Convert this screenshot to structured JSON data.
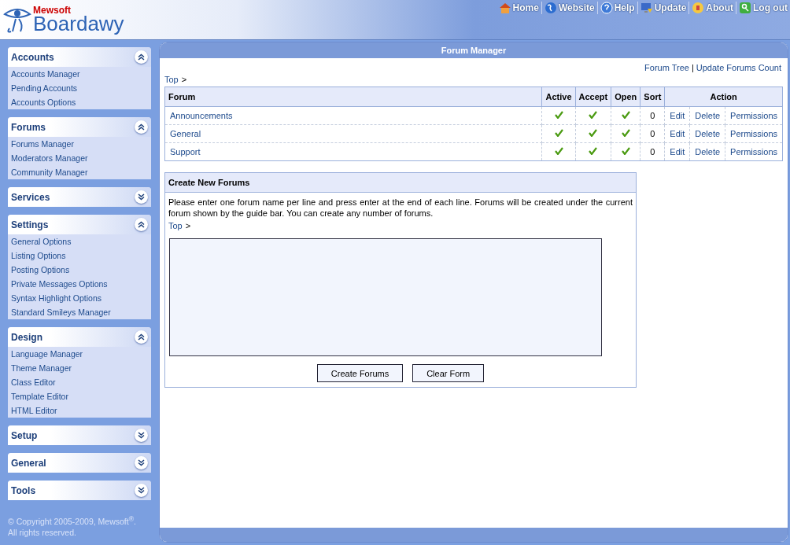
{
  "brand": {
    "maker": "Mewsoft",
    "product": "Boardawy"
  },
  "top_nav": [
    {
      "label": "Home"
    },
    {
      "label": "Website"
    },
    {
      "label": "Help"
    },
    {
      "label": "Update"
    },
    {
      "label": "About"
    },
    {
      "label": "Log out"
    }
  ],
  "sidebar": {
    "sections": [
      {
        "title": "Accounts",
        "expanded": true,
        "items": [
          "Accounts Manager",
          "Pending Accounts",
          "Accounts Options"
        ]
      },
      {
        "title": "Forums",
        "expanded": true,
        "items": [
          "Forums Manager",
          "Moderators Manager",
          "Community Manager"
        ]
      },
      {
        "title": "Services",
        "expanded": false
      },
      {
        "title": "Settings",
        "expanded": true,
        "items": [
          "General Options",
          "Listing Options",
          "Posting Options",
          "Private Messages Options",
          "Syntax Highlight Options",
          "Standard Smileys Manager"
        ]
      },
      {
        "title": "Design",
        "expanded": true,
        "items": [
          "Language Manager",
          "Theme Manager",
          "Class Editor",
          "Template Editor",
          "HTML Editor"
        ]
      },
      {
        "title": "Setup",
        "expanded": false
      },
      {
        "title": "General",
        "expanded": false
      },
      {
        "title": "Tools",
        "expanded": false
      }
    ],
    "copyright": "© Copyright 2005-2009, Mewsoft$^{®}$.",
    "rights": "All rights reserved."
  },
  "panel": {
    "title": "Forum Manager",
    "links": [
      "Forum Tree",
      "Update Forums Count"
    ],
    "link_separator": "|",
    "breadcrumb": {
      "link": "Top",
      "sep": ">"
    },
    "table": {
      "columns": [
        "Forum",
        "Active",
        "Accept",
        "Open",
        "Sort",
        "Action"
      ],
      "rows": [
        {
          "forum": "Announcements",
          "active": true,
          "accept": true,
          "open": true,
          "sort": "0",
          "actions": [
            "Edit",
            "Delete",
            "Permissions"
          ]
        },
        {
          "forum": "General",
          "active": true,
          "accept": true,
          "open": true,
          "sort": "0",
          "actions": [
            "Edit",
            "Delete",
            "Permissions"
          ]
        },
        {
          "forum": "Support",
          "active": true,
          "accept": true,
          "open": true,
          "sort": "0",
          "actions": [
            "Edit",
            "Delete",
            "Permissions"
          ]
        }
      ]
    },
    "create": {
      "title": "Create New Forums",
      "help": "Please enter one forum name per line and press enter at the end of each line. Forums will be created under the current forum shown by the guide bar. You can create any number of forums.",
      "breadcrumb": {
        "link": "Top",
        "sep": ">"
      },
      "buttons": [
        "Create Forums",
        "Clear Form"
      ]
    }
  }
}
